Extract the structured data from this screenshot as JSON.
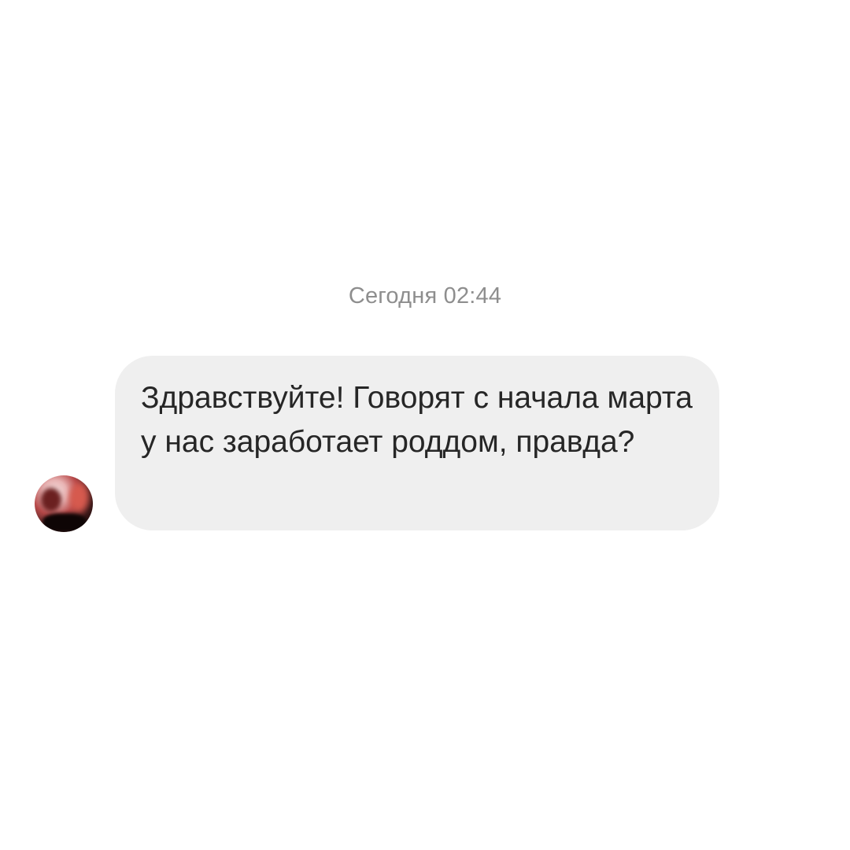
{
  "conversation": {
    "timestamp": "Сегодня 02:44",
    "messages": [
      {
        "direction": "incoming",
        "text": "Здравствуйте! Говорят с начала марта у нас заработает роддом, правда?"
      }
    ]
  },
  "colors": {
    "background": "#ffffff",
    "bubble": "#efefef",
    "message_text": "#262626",
    "timestamp_text": "#8e8e8e"
  }
}
